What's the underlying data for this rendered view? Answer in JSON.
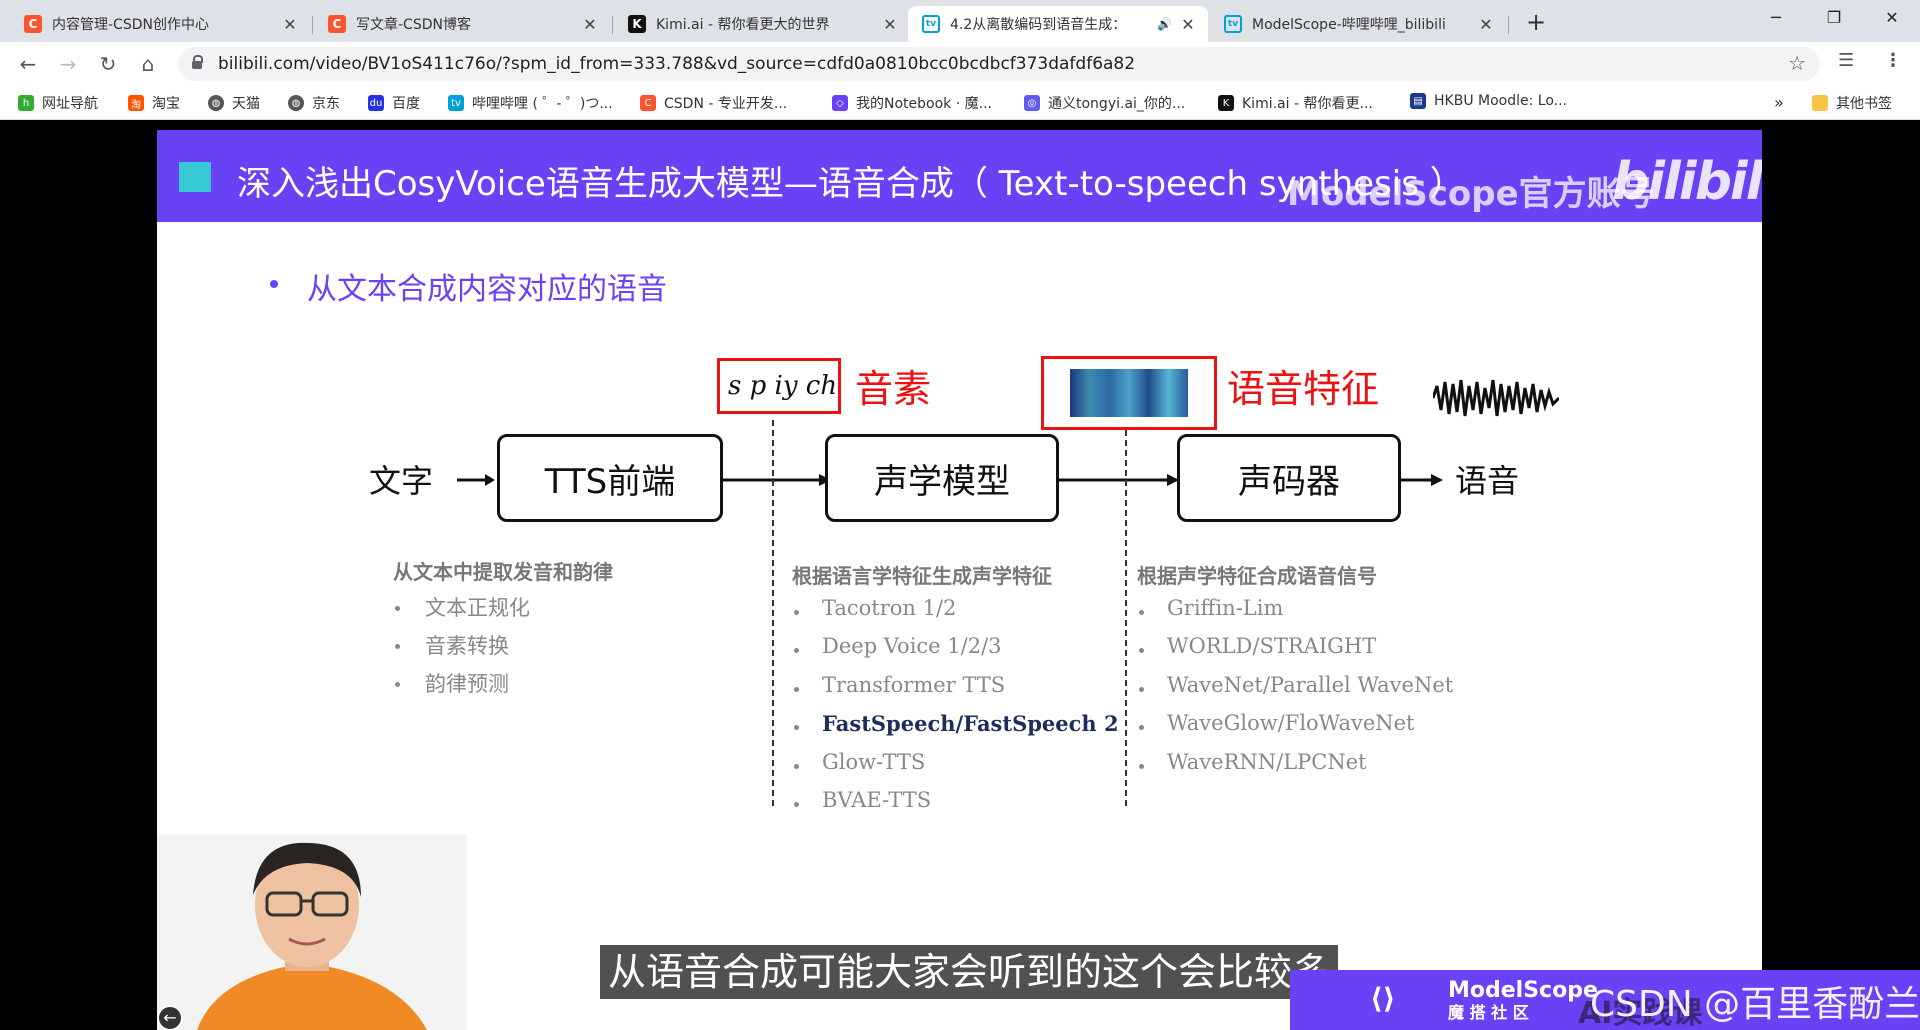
{
  "browser": {
    "tabs": [
      {
        "title": "内容管理-CSDN创作中心",
        "favicon": "csdn-icon",
        "active": false
      },
      {
        "title": "写文章-CSDN博客",
        "favicon": "csdn-icon",
        "active": false
      },
      {
        "title": "Kimi.ai - 帮你看更大的世界",
        "favicon": "kimi-icon",
        "active": false
      },
      {
        "title": "4.2从离散编码到语音生成：",
        "favicon": "bilibili-icon",
        "active": true,
        "audio": true
      },
      {
        "title": "ModelScope-哔哩哔哩_bilibili",
        "favicon": "bilibili-icon",
        "active": false
      }
    ],
    "url": "bilibili.com/video/BV1oS411c76o/?spm_id_from=333.788&vd_source=cdfd0a0810bcc0bcdbcf373dafdf6a82",
    "bookmarks": [
      {
        "label": "网址导航",
        "icon": "hao-icon"
      },
      {
        "label": "淘宝",
        "icon": "taobao-icon"
      },
      {
        "label": "天猫",
        "icon": "globe-icon"
      },
      {
        "label": "京东",
        "icon": "globe-icon"
      },
      {
        "label": "百度",
        "icon": "baidu-icon"
      },
      {
        "label": "哔哩哔哩 ( ゜- ゜)つ...",
        "icon": "bilibili-icon"
      },
      {
        "label": "CSDN - 专业开发...",
        "icon": "csdn-icon"
      },
      {
        "label": "我的Notebook · 魔...",
        "icon": "modelscope-icon"
      },
      {
        "label": "通义tongyi.ai_你的...",
        "icon": "tongyi-icon"
      },
      {
        "label": "Kimi.ai - 帮你看更...",
        "icon": "kimi-icon"
      },
      {
        "label": "HKBU Moodle: Lo...",
        "icon": "moodle-icon"
      }
    ],
    "bookmarks_overflow": "»",
    "other_bookmarks": "其他书签"
  },
  "slide": {
    "banner_title": "深入浅出CosyVoice语音生成大模型—语音合成（  Text-to-speech synthesis ）",
    "banner_watermark": "ModelScope官方账号",
    "banner_logo": "bilibili",
    "headline": "从文本合成内容对应的语音",
    "phoneme_example": "s p iy ch",
    "phoneme_label": "音素",
    "feature_label": "语音特征",
    "flow": {
      "input": "文字",
      "frontend": "TTS前端",
      "acoustic": "声学模型",
      "vocoder": "声码器",
      "output": "语音"
    },
    "col1": {
      "heading": "从文本中提取发音和韵律",
      "items": [
        "文本正规化",
        "音素转换",
        "韵律预测"
      ]
    },
    "col2": {
      "heading": "根据语言学特征生成声学特征",
      "items": [
        "Tacotron 1/2",
        "Deep Voice 1/2/3",
        "Transformer TTS",
        "FastSpeech/FastSpeech 2",
        "Glow-TTS",
        "BVAE-TTS"
      ]
    },
    "col3": {
      "heading": "根据声学特征合成语音信号",
      "items": [
        "Griffin-Lim",
        "WORLD/STRAIGHT",
        "WaveNet/Parallel WaveNet",
        "WaveGlow/FloWaveNet",
        "WaveRNN/LPCNet"
      ]
    }
  },
  "video": {
    "subtitle": "从语音合成可能大家会听到的这个会比较多",
    "modelscope_name": "ModelScope",
    "modelscope_cn": "魔 搭 社 区",
    "watermark": "CSDN @百里香酚兰",
    "watermark_behind": "AI实践课"
  }
}
